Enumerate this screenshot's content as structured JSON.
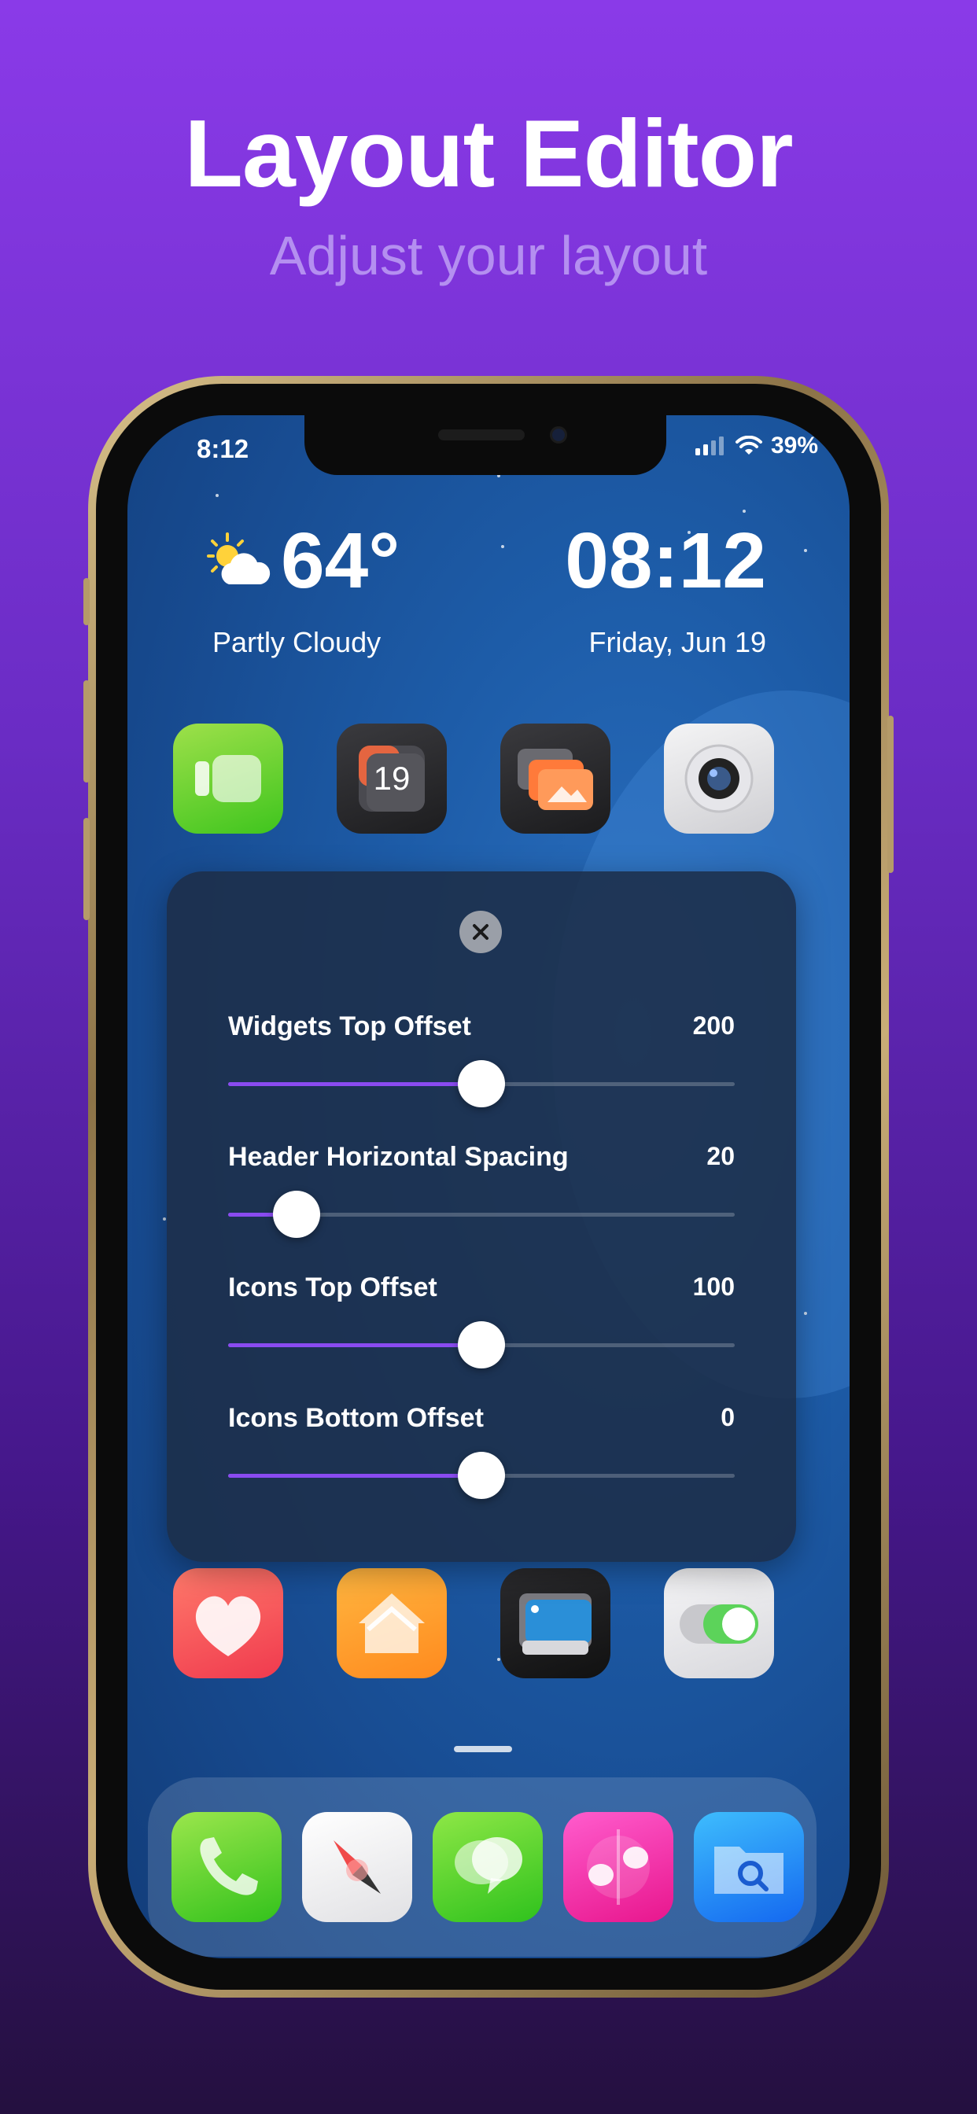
{
  "promo": {
    "title": "Layout Editor",
    "subtitle": "Adjust your layout"
  },
  "status_bar": {
    "time": "8:12",
    "battery": "39%"
  },
  "weather_widget": {
    "icon": "partly-cloudy-icon",
    "temperature": "64°",
    "condition": "Partly Cloudy"
  },
  "clock_widget": {
    "time": "08:12",
    "date": "Friday, Jun 19"
  },
  "calendar_icon_day": "19",
  "home_icons_row1": [
    "facetime-icon",
    "calendar-icon",
    "photos-icon",
    "camera-icon"
  ],
  "home_icons_row2": [
    "health-icon",
    "home-app-icon",
    "wallet-icon",
    "settings-toggle-icon"
  ],
  "dock_icons": [
    "phone-icon",
    "safari-icon",
    "messages-icon",
    "music-icon",
    "files-icon"
  ],
  "layout_panel": {
    "close_icon": "close-icon",
    "sliders": [
      {
        "label": "Widgets Top Offset",
        "value": "200",
        "fraction": 0.5
      },
      {
        "label": "Header Horizontal Spacing",
        "value": "20",
        "fraction": 0.135
      },
      {
        "label": "Icons Top Offset",
        "value": "100",
        "fraction": 0.5
      },
      {
        "label": "Icons Bottom Offset",
        "value": "0",
        "fraction": 0.5
      }
    ]
  },
  "colors": {
    "accent": "#8a4bf0",
    "background_top": "#8a3ae8",
    "background_bottom": "#24103f"
  }
}
